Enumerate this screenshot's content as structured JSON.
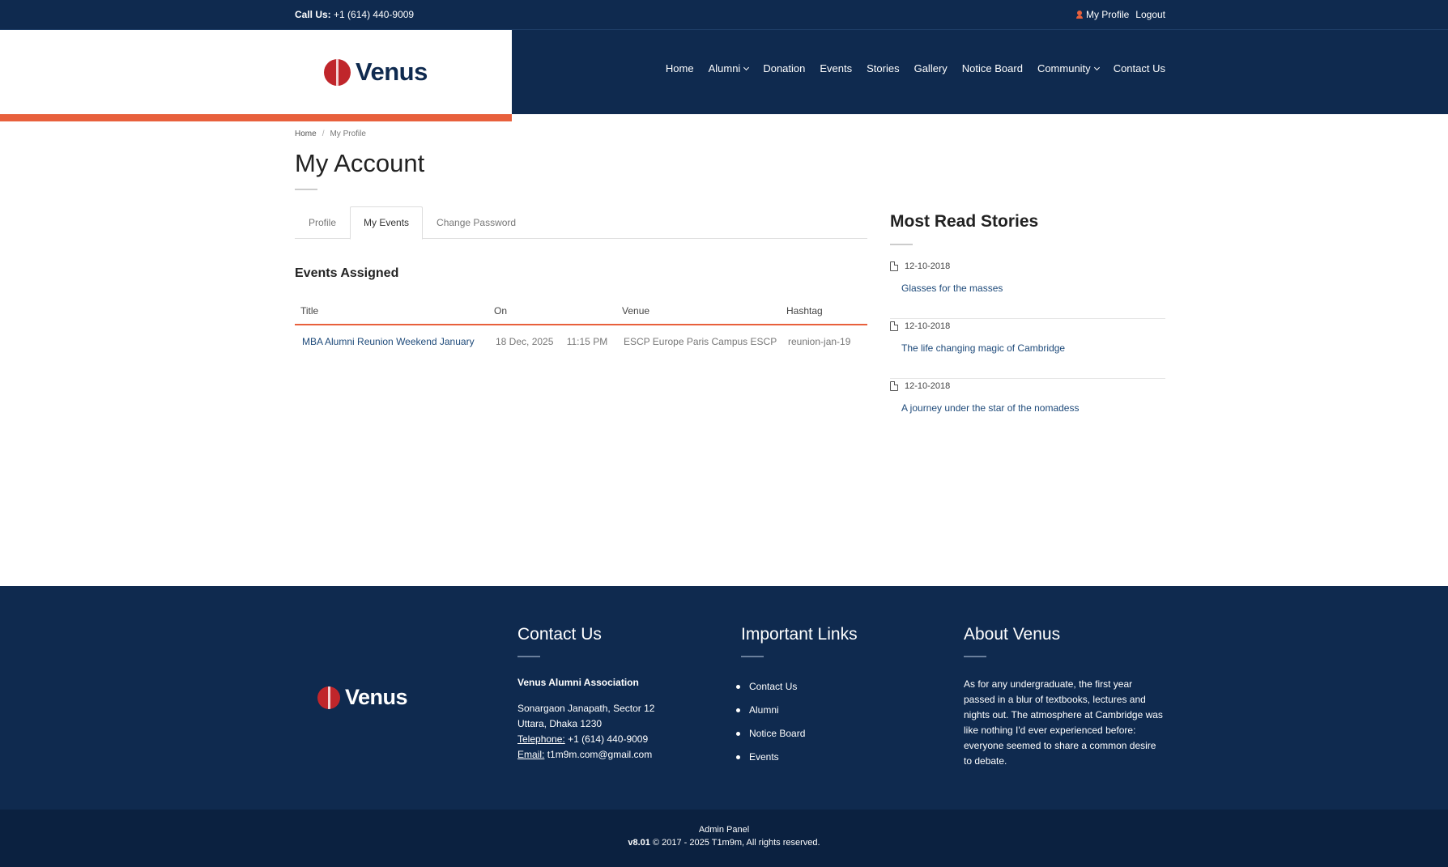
{
  "topbar": {
    "call_label": "Call Us:",
    "call_number": "+1 (614) 440-9009",
    "profile_link": "My Profile",
    "logout_link": "Logout"
  },
  "brand": {
    "name": "Venus"
  },
  "nav": {
    "items": [
      "Home",
      "Alumni",
      "Donation",
      "Events",
      "Stories",
      "Gallery",
      "Notice Board",
      "Community",
      "Contact Us"
    ]
  },
  "breadcrumb": {
    "home": "Home",
    "sep": "/",
    "current": "My Profile"
  },
  "page": {
    "title": "My Account"
  },
  "tabs": [
    "Profile",
    "My Events",
    "Change Password"
  ],
  "events": {
    "heading": "Events Assigned",
    "columns": [
      "Title",
      "On",
      "Venue",
      "Hashtag"
    ],
    "rows": [
      {
        "title": "MBA Alumni Reunion Weekend January",
        "date": "18 Dec, 2025",
        "time": "11:15 PM",
        "venue": "ESCP Europe Paris Campus ESCP",
        "hashtag": "reunion-jan-19"
      }
    ]
  },
  "sidebar": {
    "title": "Most Read Stories",
    "stories": [
      {
        "date": "12-10-2018",
        "title": "Glasses for the masses"
      },
      {
        "date": "12-10-2018",
        "title": "The life changing magic of Cambridge"
      },
      {
        "date": "12-10-2018",
        "title": "A journey under the star of the nomadess"
      }
    ]
  },
  "footer": {
    "contact": {
      "heading": "Contact Us",
      "org": "Venus Alumni Association",
      "address1": "Sonargaon Janapath, Sector 12",
      "address2": "Uttara, Dhaka 1230",
      "phone_label": "Telephone:",
      "phone": "+1 (614) 440-9009",
      "email_label": "Email:",
      "email": "t1m9m.com@gmail.com"
    },
    "links": {
      "heading": "Important Links",
      "items": [
        "Contact Us",
        "Alumni",
        "Notice Board",
        "Events"
      ]
    },
    "about": {
      "heading": "About Venus",
      "text": "As for any undergraduate, the first year passed in a blur of textbooks, lectures and nights out. The atmosphere at Cambridge was like nothing I'd ever experienced before: everyone seemed to share a common desire to debate."
    },
    "bottom": {
      "admin": "Admin Panel",
      "version": "v8.01",
      "copyright": "© 2017 - 2025 T1m9m, All rights reserved."
    }
  },
  "colors": {
    "navy": "#0f2a4f",
    "accent": "#e8603c",
    "link": "#1e4a7a",
    "logo_red": "#c0262b"
  }
}
